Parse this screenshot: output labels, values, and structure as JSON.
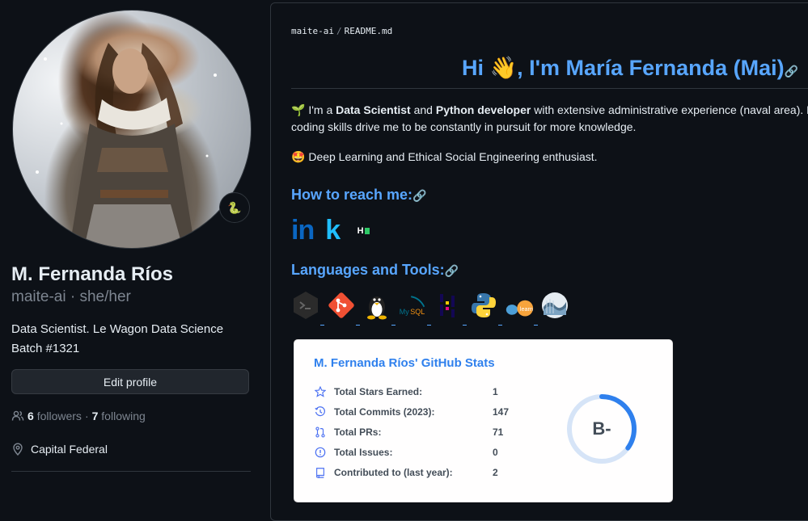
{
  "profile": {
    "name": "M. Fernanda Ríos",
    "handle": "maite-ai · she/her",
    "bio": "Data Scientist. Le Wagon Data Science Batch #1321",
    "edit_label": "Edit profile",
    "followers_count": "6",
    "followers_label": "followers",
    "following_count": "7",
    "following_label": "following",
    "dot": "·",
    "location": "Capital Federal",
    "status_emoji": "🐍"
  },
  "readme": {
    "breadcrumb_owner": "maite-ai",
    "breadcrumb_sep": "/",
    "breadcrumb_file": "README.md",
    "title": "Hi 👋, I'm María Fernanda (Mai)",
    "intro_emoji": "🌱",
    "intro_pre": "I'm a",
    "intro_role1": "Data Scientist",
    "intro_and": "and",
    "intro_role2": "Python developer",
    "intro_post": "with extensive administrative experience (naval area). My c",
    "intro_line2": "coding skills drive me to be constantly in pursuit for more knowledge.",
    "enthusiast_emoji": "🤩",
    "enthusiast": "Deep Learning and Ethical Social Engineering enthusiast.",
    "reach_heading": "How to reach me:",
    "tools_heading": "Languages and Tools:",
    "contacts": [
      {
        "name": "linkedin-icon",
        "glyph": "in"
      },
      {
        "name": "kaggle-icon",
        "glyph": "k"
      },
      {
        "name": "hackerrank-icon",
        "glyph": "H"
      }
    ]
  },
  "stats": {
    "title": "M. Fernanda Ríos' GitHub Stats",
    "rows": [
      {
        "label": "Total Stars Earned:",
        "value": "1"
      },
      {
        "label": "Total Commits (2023):",
        "value": "147"
      },
      {
        "label": "Total PRs:",
        "value": "71"
      },
      {
        "label": "Total Issues:",
        "value": "0"
      },
      {
        "label": "Contributed to (last year):",
        "value": "2"
      }
    ],
    "rank": "B-",
    "rank_progress": 0.35
  },
  "colors": {
    "accent": "#58a6ff",
    "stats_title": "#2f80ed",
    "ring": "#2f80ed"
  }
}
